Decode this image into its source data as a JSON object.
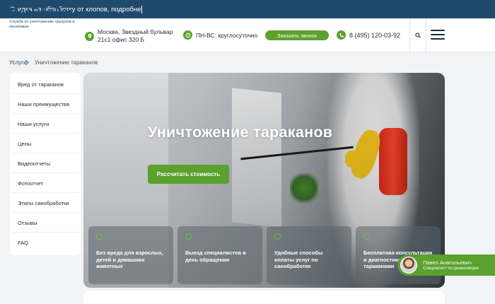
{
  "topbar": {
    "text": "Скидка на обработку от клопов, подробне"
  },
  "header": {
    "logo_name": "МосОблДез",
    "logo_tagline": "Служба по уничтожению грызунов и насекомых",
    "address_line1": "Москва, Звездный бульвар",
    "address_line2": "21с1 офис 320 Б",
    "hours": "ПН-ВС: круглосуточно",
    "call_button": "Заказать звонок",
    "phone": "8 (495) 120-03-92"
  },
  "breadcrumb": {
    "first": "Услуги",
    "current": "Уничтожение тараканов"
  },
  "sidebar": {
    "items": [
      "Вред от тараканов",
      "Наши преимущества",
      "Наши услуги",
      "Цены",
      "Видеоотчеты",
      "Фотоотчет",
      "Этапы санобработки",
      "Отзывы",
      "FAQ"
    ]
  },
  "hero": {
    "title": "Уничтожение тараканов",
    "cta": "Рассчитать стоимость",
    "features": [
      "Без вреда для взрослых, детей и домашних животных",
      "Выезд специалистов в день обращения",
      "Удобные способы оплаты услуг по санобработке",
      "Бесплатная консультация и диагностика тараканами"
    ]
  },
  "consultant": {
    "name": "Павел Анатольевич",
    "role": "Специалист по дезинсекции"
  },
  "colors": {
    "brand": "#1f4a6e",
    "accent": "#5aa12d"
  }
}
